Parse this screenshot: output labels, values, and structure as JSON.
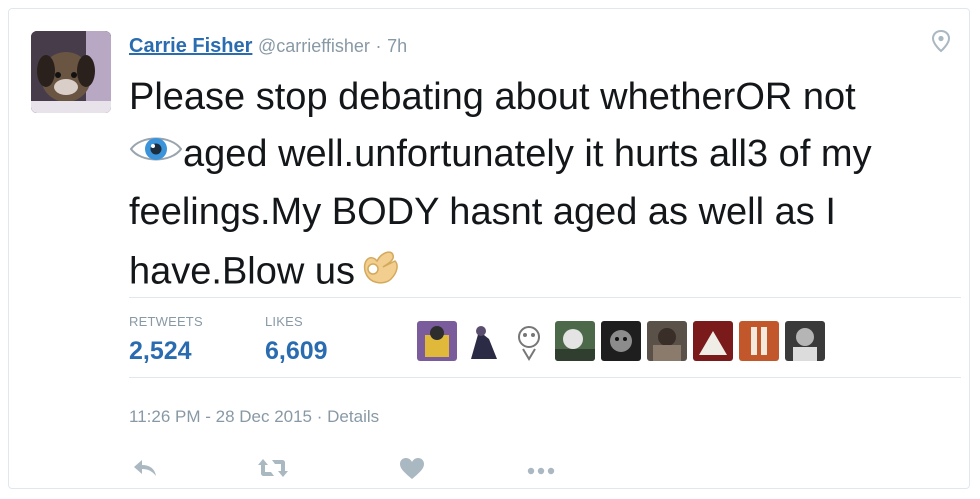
{
  "user": {
    "name": "Carrie Fisher",
    "handle": "@carrieffisher",
    "separator": "·",
    "time_ago": "7h"
  },
  "tweet": {
    "line1": "Please stop debating about whetherOR not",
    "line2": "aged well.unfortunately it hurts all3 of my",
    "line3": "feelings.My BODY hasnt aged as well as I",
    "line4": "have.Blow us"
  },
  "stats": {
    "retweets_label": "RETWEETS",
    "retweets_value": "2,524",
    "likes_label": "LIKES",
    "likes_value": "6,609"
  },
  "meta": {
    "timestamp": "11:26 PM - 28 Dec 2015",
    "separator": "·",
    "details_label": "Details"
  },
  "icons": {
    "location": "map-pin-icon",
    "eye": "eye-emoji",
    "ok": "ok-hand-emoji",
    "reply": "reply-icon",
    "retweet": "retweet-icon",
    "like": "heart-icon",
    "more": "more-icon"
  },
  "colors": {
    "link": "#2a6cb0",
    "muted": "#8899a6",
    "border": "#e1e8ed",
    "icon": "#aab8c2"
  }
}
